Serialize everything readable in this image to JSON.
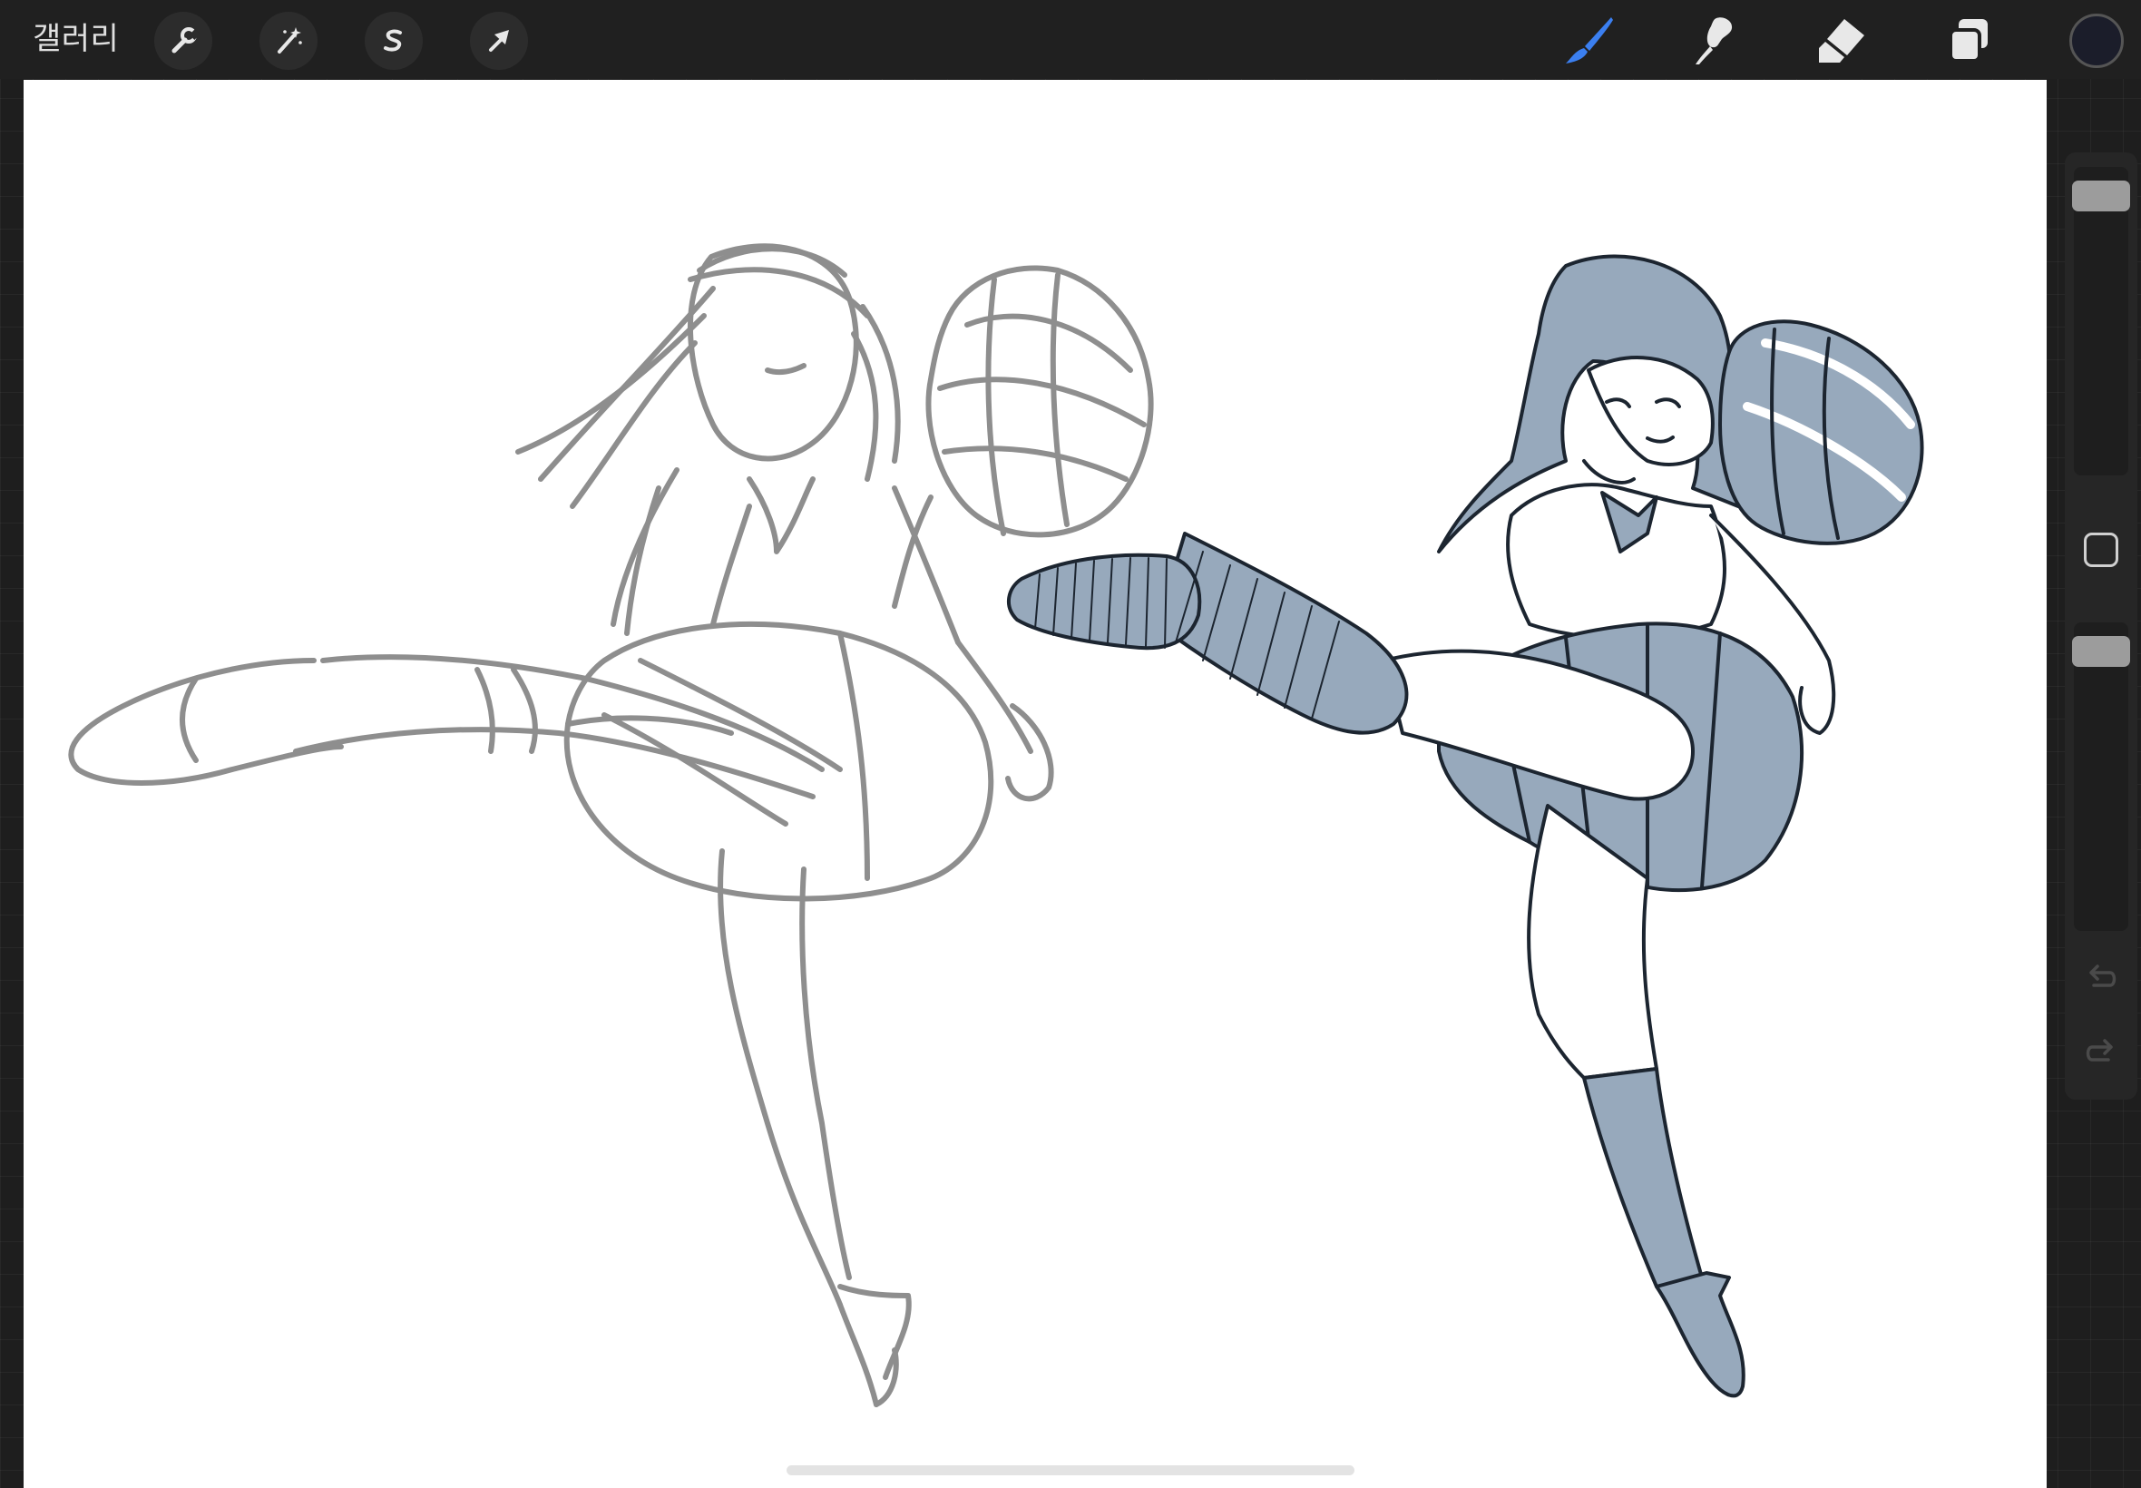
{
  "topbar": {
    "gallery_label": "갤러리",
    "left_tools": [
      {
        "name": "actions",
        "icon": "wrench-icon"
      },
      {
        "name": "adjustments",
        "icon": "magic-wand-icon"
      },
      {
        "name": "selection",
        "icon": "selection-s-icon"
      },
      {
        "name": "transform",
        "icon": "arrow-cursor-icon"
      }
    ],
    "right_tools": [
      {
        "name": "brush",
        "icon": "brush-icon",
        "active": true
      },
      {
        "name": "smudge",
        "icon": "smudge-icon"
      },
      {
        "name": "eraser",
        "icon": "eraser-icon"
      },
      {
        "name": "layers",
        "icon": "layers-icon"
      }
    ],
    "current_color": "#1b1d2a"
  },
  "sidebar": {
    "brush_size_level": 0.95,
    "opacity_level": 0.95,
    "modify_button": "square-icon",
    "undo_icon": "undo-icon",
    "redo_icon": "redo-icon"
  },
  "canvas": {
    "background": "#ffffff",
    "sketch_stroke_color": "#8e8e8e",
    "lineart_color": "#1c2530",
    "fill_color": "#97a9bc"
  },
  "colors": {
    "accent_blue": "#3b7ff0",
    "toolbar_bg": "#202020"
  }
}
